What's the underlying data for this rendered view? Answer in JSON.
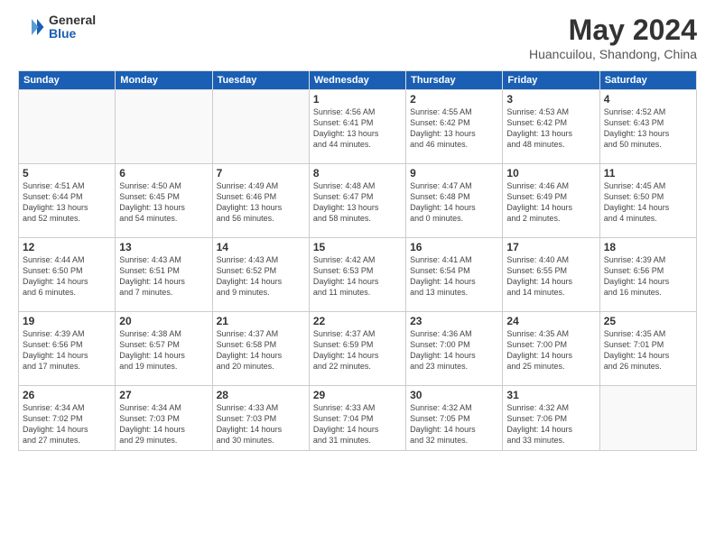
{
  "logo": {
    "general": "General",
    "blue": "Blue"
  },
  "title": "May 2024",
  "subtitle": "Huancuilou, Shandong, China",
  "headers": [
    "Sunday",
    "Monday",
    "Tuesday",
    "Wednesday",
    "Thursday",
    "Friday",
    "Saturday"
  ],
  "weeks": [
    [
      {
        "day": "",
        "info": ""
      },
      {
        "day": "",
        "info": ""
      },
      {
        "day": "",
        "info": ""
      },
      {
        "day": "1",
        "info": "Sunrise: 4:56 AM\nSunset: 6:41 PM\nDaylight: 13 hours\nand 44 minutes."
      },
      {
        "day": "2",
        "info": "Sunrise: 4:55 AM\nSunset: 6:42 PM\nDaylight: 13 hours\nand 46 minutes."
      },
      {
        "day": "3",
        "info": "Sunrise: 4:53 AM\nSunset: 6:42 PM\nDaylight: 13 hours\nand 48 minutes."
      },
      {
        "day": "4",
        "info": "Sunrise: 4:52 AM\nSunset: 6:43 PM\nDaylight: 13 hours\nand 50 minutes."
      }
    ],
    [
      {
        "day": "5",
        "info": "Sunrise: 4:51 AM\nSunset: 6:44 PM\nDaylight: 13 hours\nand 52 minutes."
      },
      {
        "day": "6",
        "info": "Sunrise: 4:50 AM\nSunset: 6:45 PM\nDaylight: 13 hours\nand 54 minutes."
      },
      {
        "day": "7",
        "info": "Sunrise: 4:49 AM\nSunset: 6:46 PM\nDaylight: 13 hours\nand 56 minutes."
      },
      {
        "day": "8",
        "info": "Sunrise: 4:48 AM\nSunset: 6:47 PM\nDaylight: 13 hours\nand 58 minutes."
      },
      {
        "day": "9",
        "info": "Sunrise: 4:47 AM\nSunset: 6:48 PM\nDaylight: 14 hours\nand 0 minutes."
      },
      {
        "day": "10",
        "info": "Sunrise: 4:46 AM\nSunset: 6:49 PM\nDaylight: 14 hours\nand 2 minutes."
      },
      {
        "day": "11",
        "info": "Sunrise: 4:45 AM\nSunset: 6:50 PM\nDaylight: 14 hours\nand 4 minutes."
      }
    ],
    [
      {
        "day": "12",
        "info": "Sunrise: 4:44 AM\nSunset: 6:50 PM\nDaylight: 14 hours\nand 6 minutes."
      },
      {
        "day": "13",
        "info": "Sunrise: 4:43 AM\nSunset: 6:51 PM\nDaylight: 14 hours\nand 7 minutes."
      },
      {
        "day": "14",
        "info": "Sunrise: 4:43 AM\nSunset: 6:52 PM\nDaylight: 14 hours\nand 9 minutes."
      },
      {
        "day": "15",
        "info": "Sunrise: 4:42 AM\nSunset: 6:53 PM\nDaylight: 14 hours\nand 11 minutes."
      },
      {
        "day": "16",
        "info": "Sunrise: 4:41 AM\nSunset: 6:54 PM\nDaylight: 14 hours\nand 13 minutes."
      },
      {
        "day": "17",
        "info": "Sunrise: 4:40 AM\nSunset: 6:55 PM\nDaylight: 14 hours\nand 14 minutes."
      },
      {
        "day": "18",
        "info": "Sunrise: 4:39 AM\nSunset: 6:56 PM\nDaylight: 14 hours\nand 16 minutes."
      }
    ],
    [
      {
        "day": "19",
        "info": "Sunrise: 4:39 AM\nSunset: 6:56 PM\nDaylight: 14 hours\nand 17 minutes."
      },
      {
        "day": "20",
        "info": "Sunrise: 4:38 AM\nSunset: 6:57 PM\nDaylight: 14 hours\nand 19 minutes."
      },
      {
        "day": "21",
        "info": "Sunrise: 4:37 AM\nSunset: 6:58 PM\nDaylight: 14 hours\nand 20 minutes."
      },
      {
        "day": "22",
        "info": "Sunrise: 4:37 AM\nSunset: 6:59 PM\nDaylight: 14 hours\nand 22 minutes."
      },
      {
        "day": "23",
        "info": "Sunrise: 4:36 AM\nSunset: 7:00 PM\nDaylight: 14 hours\nand 23 minutes."
      },
      {
        "day": "24",
        "info": "Sunrise: 4:35 AM\nSunset: 7:00 PM\nDaylight: 14 hours\nand 25 minutes."
      },
      {
        "day": "25",
        "info": "Sunrise: 4:35 AM\nSunset: 7:01 PM\nDaylight: 14 hours\nand 26 minutes."
      }
    ],
    [
      {
        "day": "26",
        "info": "Sunrise: 4:34 AM\nSunset: 7:02 PM\nDaylight: 14 hours\nand 27 minutes."
      },
      {
        "day": "27",
        "info": "Sunrise: 4:34 AM\nSunset: 7:03 PM\nDaylight: 14 hours\nand 29 minutes."
      },
      {
        "day": "28",
        "info": "Sunrise: 4:33 AM\nSunset: 7:03 PM\nDaylight: 14 hours\nand 30 minutes."
      },
      {
        "day": "29",
        "info": "Sunrise: 4:33 AM\nSunset: 7:04 PM\nDaylight: 14 hours\nand 31 minutes."
      },
      {
        "day": "30",
        "info": "Sunrise: 4:32 AM\nSunset: 7:05 PM\nDaylight: 14 hours\nand 32 minutes."
      },
      {
        "day": "31",
        "info": "Sunrise: 4:32 AM\nSunset: 7:06 PM\nDaylight: 14 hours\nand 33 minutes."
      },
      {
        "day": "",
        "info": ""
      }
    ]
  ]
}
